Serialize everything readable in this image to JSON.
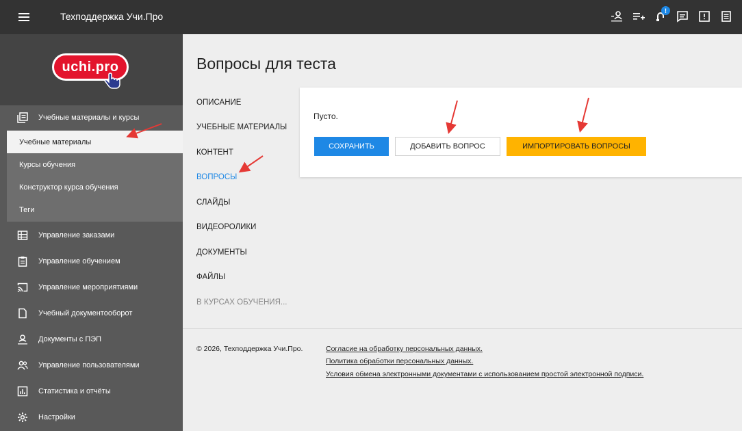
{
  "header": {
    "app_title": "Техподдержка Учи.Про",
    "notification_badge": "!"
  },
  "sidebar": {
    "logo_text": "uchi.pro",
    "sections": [
      {
        "label": "Учебные материалы и курсы",
        "icon": "library-icon"
      },
      {
        "label": "Управление заказами",
        "icon": "table-icon"
      },
      {
        "label": "Управление обучением",
        "icon": "clipboard-icon"
      },
      {
        "label": "Управление мероприятиями",
        "icon": "cast-icon"
      },
      {
        "label": "Учебный документооборот",
        "icon": "document-icon"
      },
      {
        "label": "Документы с ПЭП",
        "icon": "signature-icon"
      },
      {
        "label": "Управление пользователями",
        "icon": "users-icon"
      },
      {
        "label": "Статистика и отчёты",
        "icon": "chart-icon"
      },
      {
        "label": "Настройки",
        "icon": "gear-icon"
      }
    ],
    "subitems": [
      {
        "label": "Учебные материалы",
        "active": true
      },
      {
        "label": "Курсы обучения"
      },
      {
        "label": "Конструктор курса обучения"
      },
      {
        "label": "Теги"
      }
    ]
  },
  "main": {
    "title": "Вопросы для теста",
    "tabs": [
      {
        "label": "ОПИСАНИЕ"
      },
      {
        "label": "УЧЕБНЫЕ МАТЕРИАЛЫ"
      },
      {
        "label": "КОНТЕНТ"
      },
      {
        "label": "ВОПРОСЫ",
        "active": true
      },
      {
        "label": "СЛАЙДЫ"
      },
      {
        "label": "ВИДЕОРОЛИКИ"
      },
      {
        "label": "ДОКУМЕНТЫ"
      },
      {
        "label": "ФАЙЛЫ"
      },
      {
        "label": "В КУРСАХ ОБУЧЕНИЯ..."
      }
    ],
    "empty_text": "Пусто.",
    "buttons": {
      "save": "СОХРАНИТЬ",
      "add_question": "ДОБАВИТЬ ВОПРОС",
      "import_questions": "ИМПОРТИРОВАТЬ ВОПРОСЫ"
    }
  },
  "footer": {
    "copyright": "© 2026, Техподдержка Учи.Про.",
    "links": [
      "Согласие на обработку персональных данных.",
      "Политика обработки персональных данных.",
      "Условия обмена электронными документами с использованием простой электронной подписи."
    ]
  },
  "colors": {
    "topbar": "#333333",
    "sidebar": "#595959",
    "accent_blue": "#1e88e5",
    "accent_orange": "#ffb300",
    "logo_red": "#e3142d",
    "annotation_arrow": "#e53935"
  }
}
